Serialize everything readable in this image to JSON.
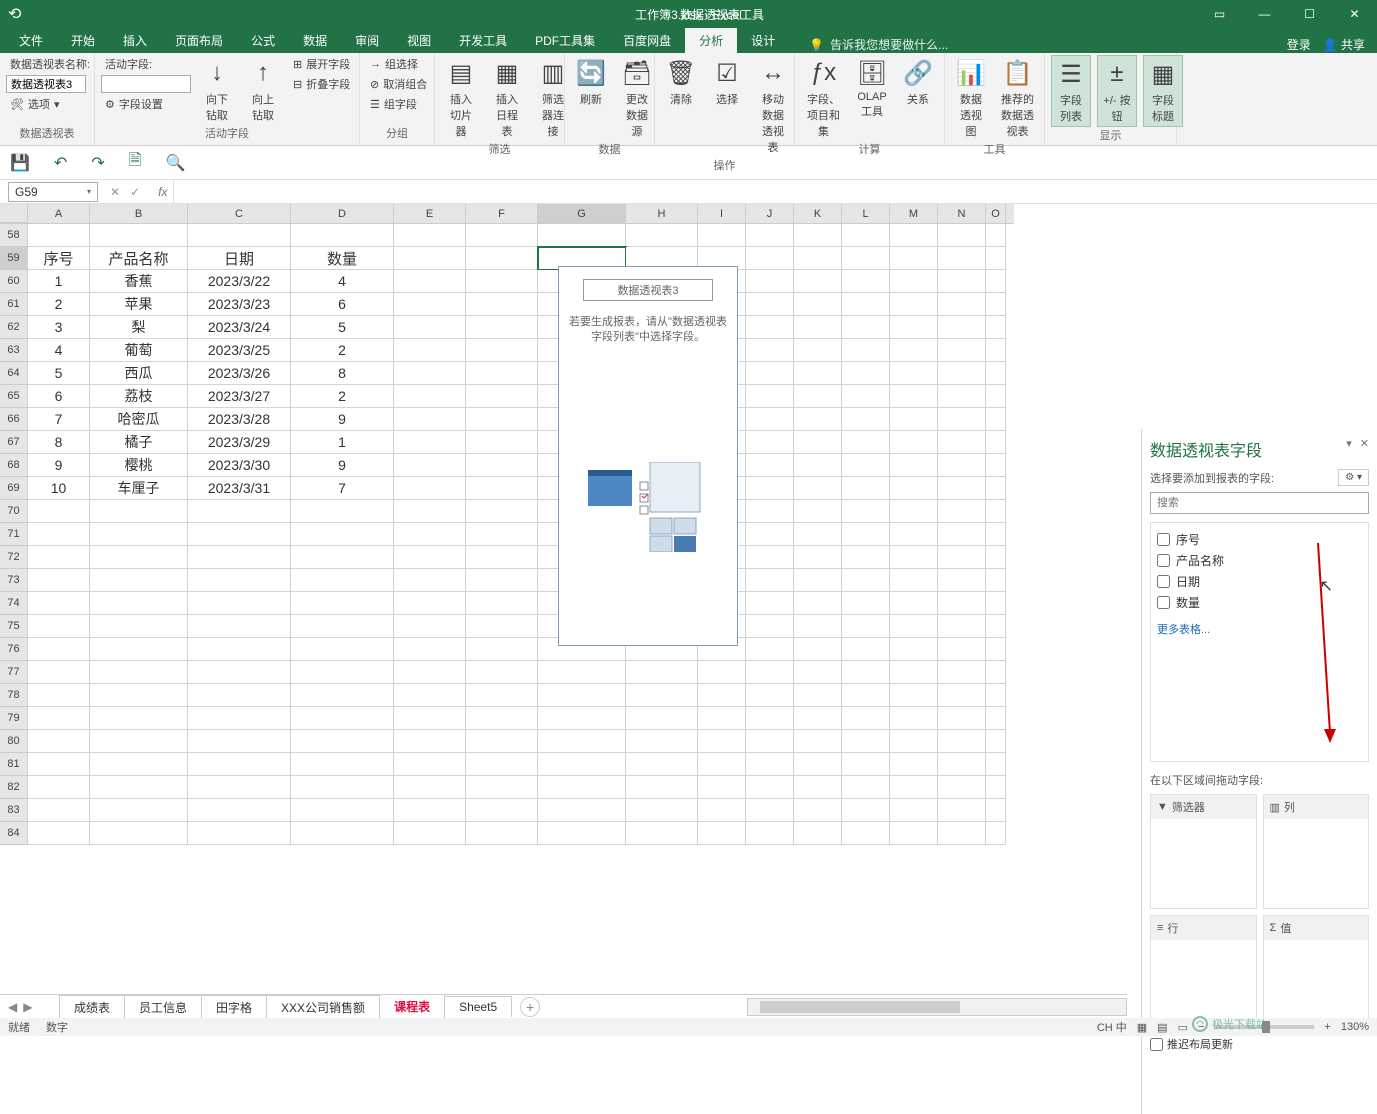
{
  "titleBar": {
    "docTitle": "工作簿3.xlsx - Excel",
    "toolTitle": "数据透视表工具",
    "login": "登录",
    "share": "共享"
  },
  "tabs": {
    "items": [
      "文件",
      "开始",
      "插入",
      "页面布局",
      "公式",
      "数据",
      "审阅",
      "视图",
      "开发工具",
      "PDF工具集",
      "百度网盘",
      "分析",
      "设计"
    ],
    "activeIndex": 11,
    "tellMe": "告诉我您想要做什么..."
  },
  "ribbon": {
    "g0": {
      "nameLabel": "数据透视表名称:",
      "nameValue": "数据透视表3",
      "options": "选项",
      "groupLabel": "数据透视表"
    },
    "g1": {
      "activeFieldLabel": "活动字段:",
      "fieldValue": "",
      "drillDown": "向下钻取",
      "drillUp": "向上钻取",
      "expand": "展开字段",
      "collapse": "折叠字段",
      "fieldSettings": "字段设置",
      "groupLabel": "活动字段"
    },
    "g2": {
      "groupSel": "组选择",
      "ungroup": "取消组合",
      "groupField": "组字段",
      "groupLabel": "分组"
    },
    "g3": {
      "slicer": "插入切片器",
      "timeline": "插入日程表",
      "filterConn": "筛选器连接",
      "groupLabel": "筛选"
    },
    "g4": {
      "refresh": "刷新",
      "changeData": "更改数据源",
      "groupLabel": "数据"
    },
    "g5": {
      "clear": "清除",
      "select": "选择",
      "move": "移动数据透视表",
      "groupLabel": "操作"
    },
    "g6": {
      "fieldsItems": "字段、项目和集",
      "olap": "OLAP 工具",
      "relations": "关系",
      "groupLabel": "计算"
    },
    "g7": {
      "pivotChart": "数据透视图",
      "recommended": "推荐的数据透视表",
      "groupLabel": "工具"
    },
    "g8": {
      "fieldList": "字段列表",
      "buttons": "+/- 按钮",
      "headers": "字段标题",
      "groupLabel": "显示"
    }
  },
  "nameBox": "G59",
  "columns": [
    "A",
    "B",
    "C",
    "D",
    "E",
    "F",
    "G",
    "H",
    "I",
    "J",
    "K",
    "L",
    "M",
    "N",
    "O"
  ],
  "rows": {
    "start": 58,
    "end": 84,
    "headers": [
      "序号",
      "产品名称",
      "日期",
      "数量"
    ],
    "data": [
      [
        "1",
        "香蕉",
        "2023/3/22",
        "4"
      ],
      [
        "2",
        "苹果",
        "2023/3/23",
        "6"
      ],
      [
        "3",
        "梨",
        "2023/3/24",
        "5"
      ],
      [
        "4",
        "葡萄",
        "2023/3/25",
        "2"
      ],
      [
        "5",
        "西瓜",
        "2023/3/26",
        "8"
      ],
      [
        "6",
        "荔枝",
        "2023/3/27",
        "2"
      ],
      [
        "7",
        "哈密瓜",
        "2023/3/28",
        "9"
      ],
      [
        "8",
        "橘子",
        "2023/3/29",
        "1"
      ],
      [
        "9",
        "樱桃",
        "2023/3/30",
        "9"
      ],
      [
        "10",
        "车厘子",
        "2023/3/31",
        "7"
      ]
    ]
  },
  "pivotOverlay": {
    "title": "数据透视表3",
    "msg": "若要生成报表，请从\"数据透视表字段列表\"中选择字段。"
  },
  "taskPane": {
    "title": "数据透视表字段",
    "instruction": "选择要添加到报表的字段:",
    "searchPlaceholder": "搜索",
    "fields": [
      "序号",
      "产品名称",
      "日期",
      "数量"
    ],
    "moreTables": "更多表格...",
    "dragLabel": "在以下区域间拖动字段:",
    "zones": {
      "filter": "筛选器",
      "columns": "列",
      "rows": "行",
      "values": "值"
    },
    "defer": "推迟布局更新"
  },
  "sheetTabs": {
    "items": [
      "成绩表",
      "员工信息",
      "田字格",
      "XXX公司销售额",
      "课程表",
      "Sheet5"
    ],
    "activeIndex": 4
  },
  "statusBar": {
    "ready": "就绪",
    "num": "数字",
    "ime": "CH 中",
    "zoom": "130%"
  },
  "watermark": "极光下载站"
}
